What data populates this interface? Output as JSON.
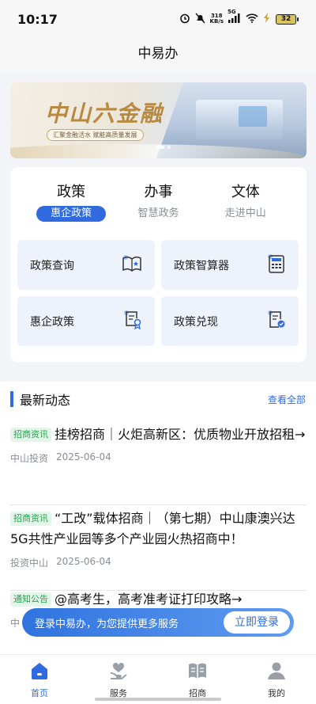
{
  "status": {
    "time": "10:17",
    "netspeed_value": "318",
    "netspeed_unit": "KB/s",
    "network": "5G",
    "battery": "32"
  },
  "header": {
    "title": "中易办"
  },
  "banner": {
    "title": "中山六金融",
    "subtitle": "汇聚金融活水 赋能高质量发展"
  },
  "service": {
    "tabs": [
      {
        "label": "政策",
        "sub": "惠企政策"
      },
      {
        "label": "办事",
        "sub": "智慧政务"
      },
      {
        "label": "文体",
        "sub": "走进中山"
      }
    ],
    "tiles": [
      {
        "label": "政策查询",
        "icon": "policy-book-icon"
      },
      {
        "label": "政策智算器",
        "icon": "calculator-icon"
      },
      {
        "label": "惠企政策",
        "icon": "certificate-icon"
      },
      {
        "label": "政策兑现",
        "icon": "verified-document-icon"
      }
    ]
  },
  "news": {
    "title": "最新动态",
    "more": "查看全部",
    "items": [
      {
        "tag": "招商资讯",
        "text": "挂榜招商｜火炬高新区：优质物业开放招租→",
        "source": "中山投资",
        "date": "2025-06-04"
      },
      {
        "tag": "招商资讯",
        "text": "“工改”载体招商｜（第七期）中山康澳兴达5G共性产业园等多个产业园火热招商中！",
        "source": "投资中山",
        "date": "2025-06-04"
      },
      {
        "tag": "通知公告",
        "text": "@高考生，高考准考证打印攻略→",
        "source": "中"
      }
    ]
  },
  "login": {
    "text": "登录中易办，为您提供更多服务",
    "button": "立即登录"
  },
  "tabbar": [
    {
      "label": "首页",
      "icon": "home-icon",
      "active": true
    },
    {
      "label": "服务",
      "icon": "service-heart-icon"
    },
    {
      "label": "招商",
      "icon": "investment-book-icon"
    },
    {
      "label": "我的",
      "icon": "profile-icon"
    }
  ],
  "colors": {
    "accent": "#2f6bde",
    "tag_green": "#23a34d"
  }
}
